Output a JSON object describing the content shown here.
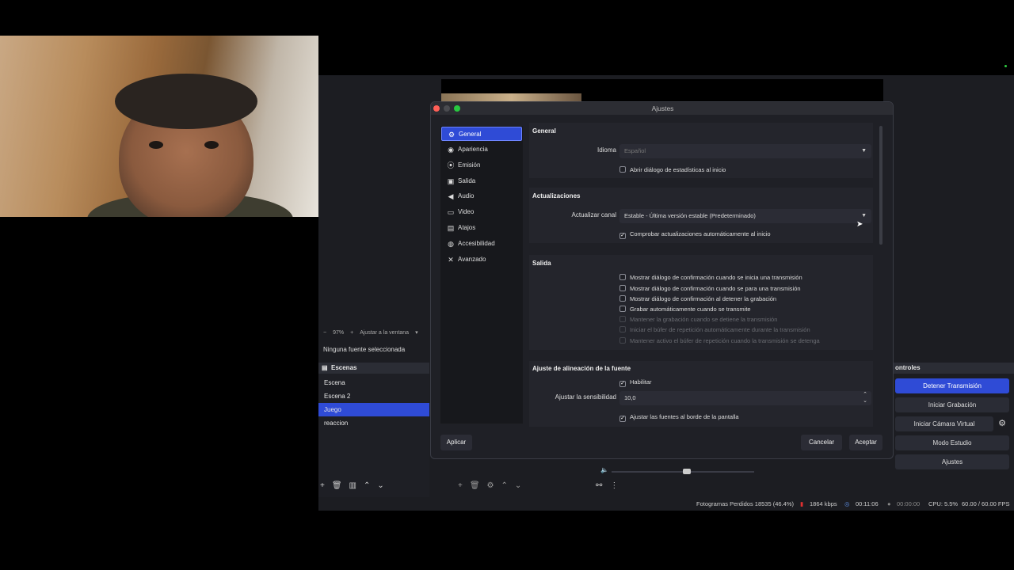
{
  "dialog": {
    "title": "Ajustes",
    "nav": [
      {
        "label": "General",
        "icon": "gear-icon",
        "glyph": "⚙"
      },
      {
        "label": "Apariencia",
        "icon": "palette-icon",
        "glyph": "◉"
      },
      {
        "label": "Emisión",
        "icon": "broadcast-icon",
        "glyph": "⦿"
      },
      {
        "label": "Salida",
        "icon": "output-icon",
        "glyph": "▣"
      },
      {
        "label": "Audio",
        "icon": "speaker-icon",
        "glyph": "◀"
      },
      {
        "label": "Video",
        "icon": "monitor-icon",
        "glyph": "▭"
      },
      {
        "label": "Atajos",
        "icon": "keyboard-icon",
        "glyph": "▤"
      },
      {
        "label": "Accesibilidad",
        "icon": "accessibility-icon",
        "glyph": "◍"
      },
      {
        "label": "Avanzado",
        "icon": "tools-icon",
        "glyph": "✕"
      }
    ],
    "general": {
      "title": "General",
      "language_label": "Idioma",
      "language_value": "Español",
      "stats_check": "Abrir diálogo de estadísticas al inicio"
    },
    "updates": {
      "title": "Actualizaciones",
      "channel_label": "Actualizar canal",
      "channel_value": "Estable - Última versión estable (Predeterminado)",
      "auto_check": "Comprobar actualizaciones automáticamente al inicio"
    },
    "output": {
      "title": "Salida",
      "checks": [
        "Mostrar diálogo de confirmación cuando se inicia una transmisión",
        "Mostrar diálogo de confirmación cuando se para una transmisión",
        "Mostrar diálogo de confirmación al detener la grabación",
        "Grabar automáticamente cuando se transmite",
        "Mantener la grabación cuando se detiene la transmisión",
        "Iniciar el búfer de repetición automáticamente durante la transmisión",
        "Mantener activo el búfer de repetición cuando la transmisión se detenga"
      ]
    },
    "snap": {
      "title": "Ajuste de alineación de la fuente",
      "enable": "Habilitar",
      "sensitivity_label": "Ajustar la sensibilidad",
      "sensitivity_value": "10,0",
      "edges": "Ajustar las fuentes al borde de la pantalla"
    },
    "apply": "Aplicar",
    "cancel": "Cancelar",
    "accept": "Aceptar"
  },
  "obs": {
    "zoom": "97%",
    "fit": "Ajustar a la ventana",
    "no_source": "Ninguna fuente seleccionada",
    "scenes_title": "Escenas",
    "scenes": [
      "Escena",
      "Escena 2",
      "Juego",
      "reaccion"
    ],
    "selected_scene_index": 2,
    "controls_title": "ontroles",
    "controls": [
      "Detener Transmisión",
      "Iniciar Grabación",
      "Iniciar Cámara Virtual",
      "Modo Estudio",
      "Ajustes"
    ],
    "status": {
      "dropped": "Fotogramas Perdidos 18535 (46.4%)",
      "bitrate": "1864 kbps",
      "stream_time": "00:11:06",
      "rec_time": "00:00:00",
      "cpu": "CPU: 5.5%",
      "fps": "60.00 / 60.00 FPS"
    }
  },
  "colors": {
    "accent": "#2f4bd6",
    "panel": "#1f2026",
    "live": "#e03030"
  }
}
